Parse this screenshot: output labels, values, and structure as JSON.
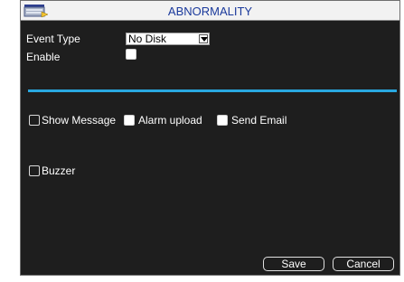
{
  "window": {
    "title": "ABNORMALITY",
    "title_icon": "folder-tray-icon"
  },
  "form": {
    "event_type_label": "Event Type",
    "event_type_value": "No Disk",
    "enable_label": "Enable",
    "enable_checked": false
  },
  "options": {
    "show_message_label": "Show Message",
    "show_message_checked": false,
    "alarm_upload_label": "Alarm upload",
    "alarm_upload_checked": false,
    "send_email_label": "Send Email",
    "send_email_checked": false,
    "buzzer_label": "Buzzer",
    "buzzer_checked": false
  },
  "buttons": {
    "save_label": "Save",
    "cancel_label": "Cancel"
  },
  "colors": {
    "accent": "#29a8e0",
    "background": "#1e1e1e",
    "title_text": "#1b3a9c"
  }
}
